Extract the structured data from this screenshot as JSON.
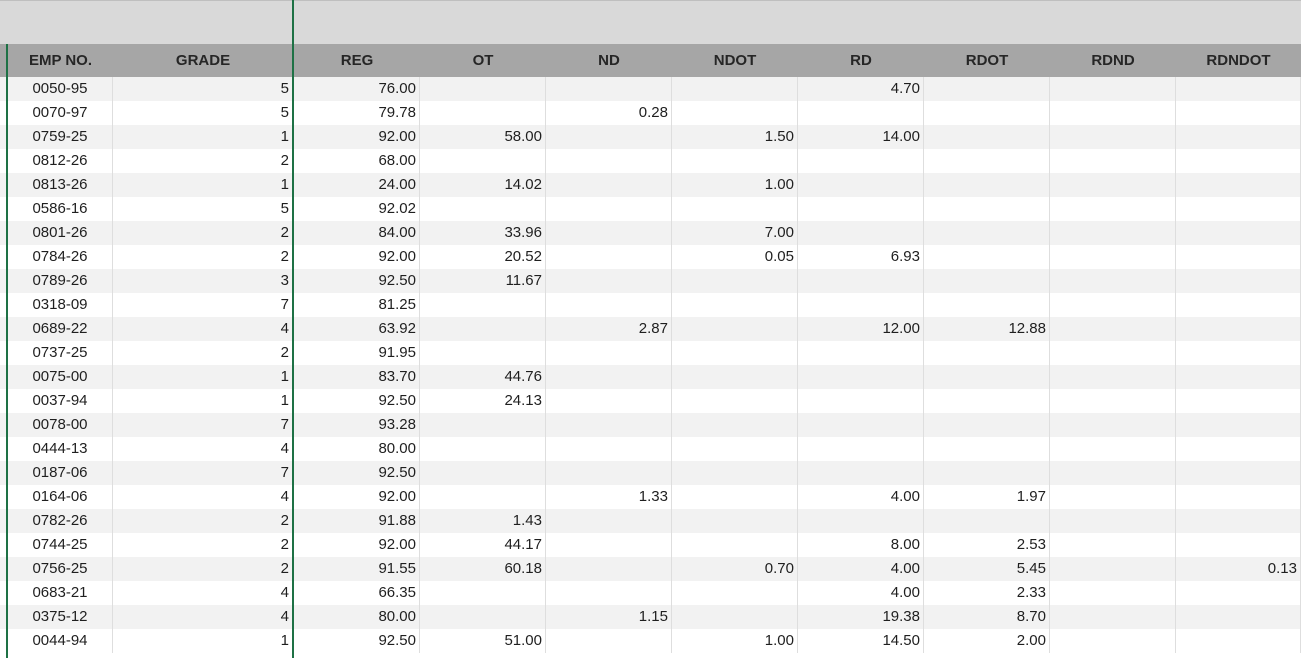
{
  "columns": [
    "EMP NO.",
    "GRADE",
    "REG",
    "OT",
    "ND",
    "NDOT",
    "RD",
    "RDOT",
    "RDND",
    "RDNDOT"
  ],
  "rows": [
    [
      "0050-95",
      "5",
      "76.00",
      "",
      "",
      "",
      "4.70",
      "",
      "",
      ""
    ],
    [
      "0070-97",
      "5",
      "79.78",
      "",
      "0.28",
      "",
      "",
      "",
      "",
      ""
    ],
    [
      "0759-25",
      "1",
      "92.00",
      "58.00",
      "",
      "1.50",
      "14.00",
      "",
      "",
      ""
    ],
    [
      "0812-26",
      "2",
      "68.00",
      "",
      "",
      "",
      "",
      "",
      "",
      ""
    ],
    [
      "0813-26",
      "1",
      "24.00",
      "14.02",
      "",
      "1.00",
      "",
      "",
      "",
      ""
    ],
    [
      "0586-16",
      "5",
      "92.02",
      "",
      "",
      "",
      "",
      "",
      "",
      ""
    ],
    [
      "0801-26",
      "2",
      "84.00",
      "33.96",
      "",
      "7.00",
      "",
      "",
      "",
      ""
    ],
    [
      "0784-26",
      "2",
      "92.00",
      "20.52",
      "",
      "0.05",
      "6.93",
      "",
      "",
      ""
    ],
    [
      "0789-26",
      "3",
      "92.50",
      "11.67",
      "",
      "",
      "",
      "",
      "",
      ""
    ],
    [
      "0318-09",
      "7",
      "81.25",
      "",
      "",
      "",
      "",
      "",
      "",
      ""
    ],
    [
      "0689-22",
      "4",
      "63.92",
      "",
      "2.87",
      "",
      "12.00",
      "12.88",
      "",
      ""
    ],
    [
      "0737-25",
      "2",
      "91.95",
      "",
      "",
      "",
      "",
      "",
      "",
      ""
    ],
    [
      "0075-00",
      "1",
      "83.70",
      "44.76",
      "",
      "",
      "",
      "",
      "",
      ""
    ],
    [
      "0037-94",
      "1",
      "92.50",
      "24.13",
      "",
      "",
      "",
      "",
      "",
      ""
    ],
    [
      "0078-00",
      "7",
      "93.28",
      "",
      "",
      "",
      "",
      "",
      "",
      ""
    ],
    [
      "0444-13",
      "4",
      "80.00",
      "",
      "",
      "",
      "",
      "",
      "",
      ""
    ],
    [
      "0187-06",
      "7",
      "92.50",
      "",
      "",
      "",
      "",
      "",
      "",
      ""
    ],
    [
      "0164-06",
      "4",
      "92.00",
      "",
      "1.33",
      "",
      "4.00",
      "1.97",
      "",
      ""
    ],
    [
      "0782-26",
      "2",
      "91.88",
      "1.43",
      "",
      "",
      "",
      "",
      "",
      ""
    ],
    [
      "0744-25",
      "2",
      "92.00",
      "44.17",
      "",
      "",
      "8.00",
      "2.53",
      "",
      ""
    ],
    [
      "0756-25",
      "2",
      "91.55",
      "60.18",
      "",
      "0.70",
      "4.00",
      "5.45",
      "",
      "0.13"
    ],
    [
      "0683-21",
      "4",
      "66.35",
      "",
      "",
      "",
      "4.00",
      "2.33",
      "",
      ""
    ],
    [
      "0375-12",
      "4",
      "80.00",
      "",
      "1.15",
      "",
      "19.38",
      "8.70",
      "",
      ""
    ],
    [
      "0044-94",
      "1",
      "92.50",
      "51.00",
      "",
      "1.00",
      "14.50",
      "2.00",
      "",
      ""
    ]
  ]
}
